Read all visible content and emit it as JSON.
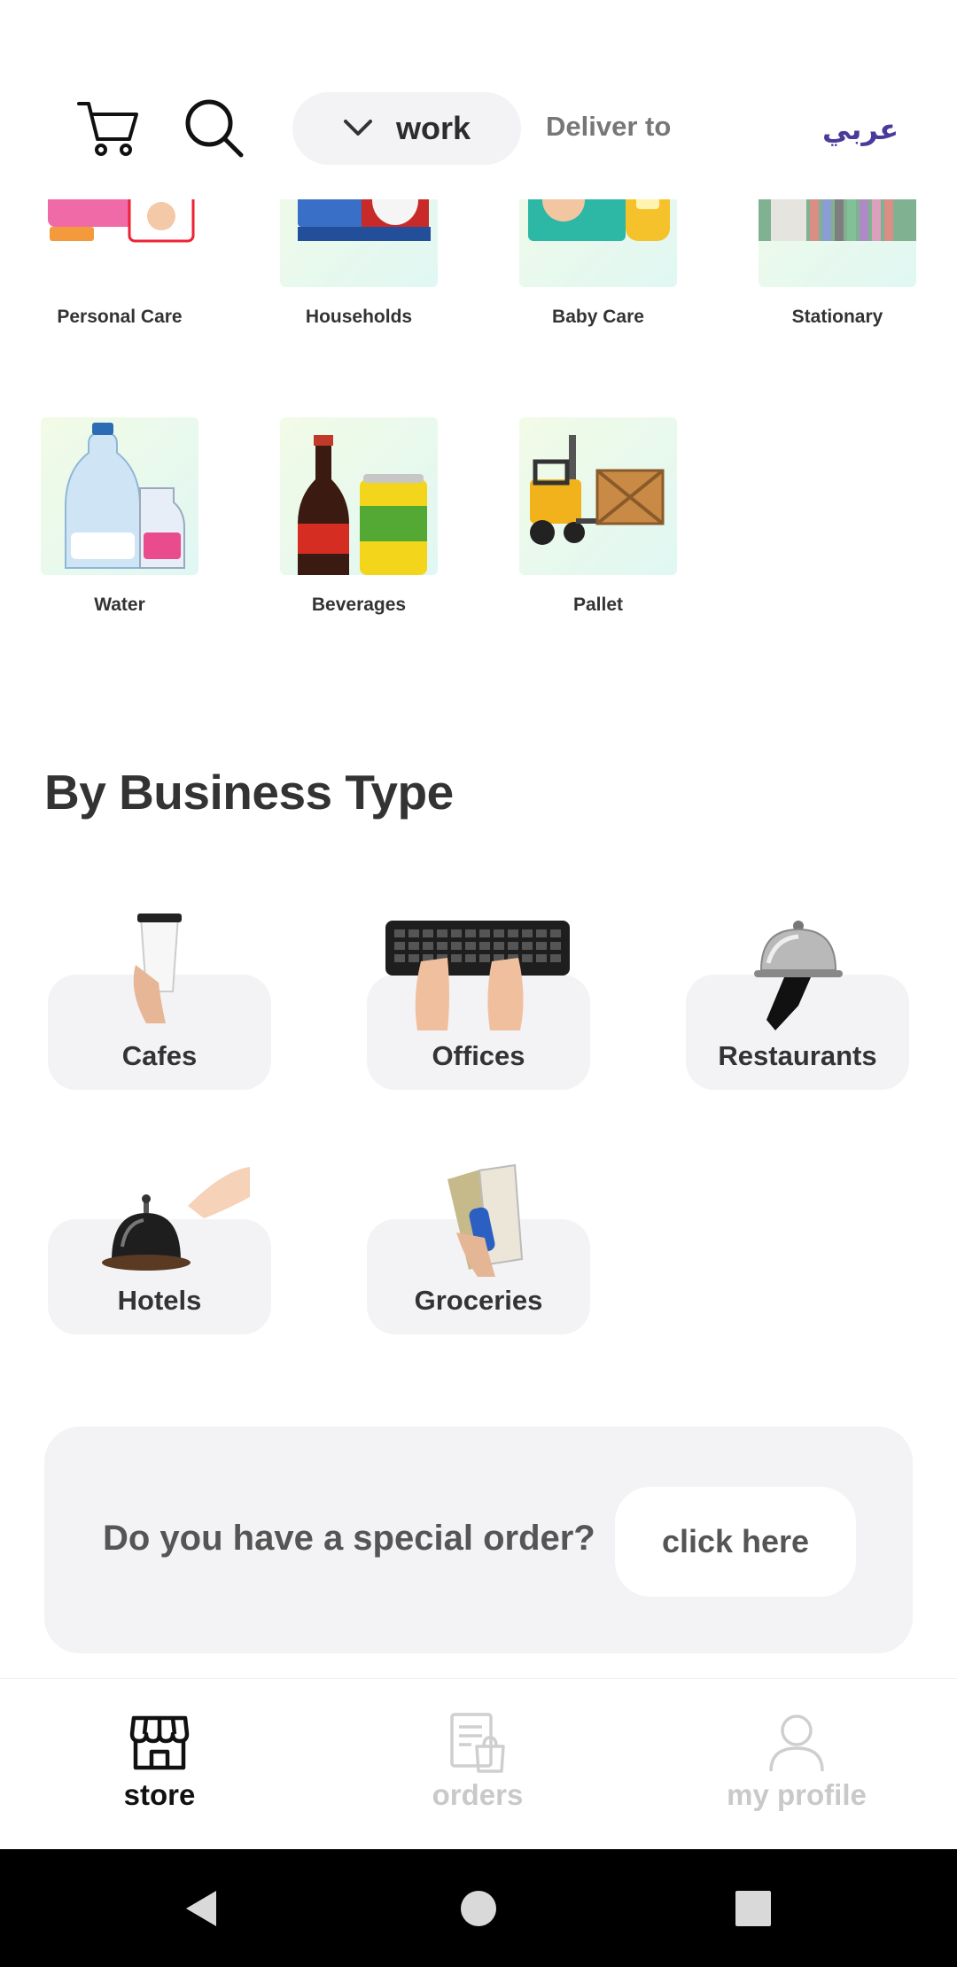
{
  "header": {
    "location_value": "work",
    "deliver_label": "Deliver to",
    "language_toggle": "عربي"
  },
  "categories": [
    {
      "label": "Personal Care"
    },
    {
      "label": "Households"
    },
    {
      "label": "Baby Care"
    },
    {
      "label": "Stationary"
    },
    {
      "label": "Water"
    },
    {
      "label": "Beverages"
    },
    {
      "label": "Pallet"
    }
  ],
  "business": {
    "title": "By Business Type",
    "items": [
      {
        "label": "Cafes"
      },
      {
        "label": "Offices"
      },
      {
        "label": "Restaurants"
      },
      {
        "label": "Hotels"
      },
      {
        "label": "Groceries"
      }
    ]
  },
  "special_order": {
    "question": "Do you have a special order?",
    "button": "click here"
  },
  "bottom_nav": {
    "store": "store",
    "orders": "orders",
    "profile": "my profile"
  }
}
